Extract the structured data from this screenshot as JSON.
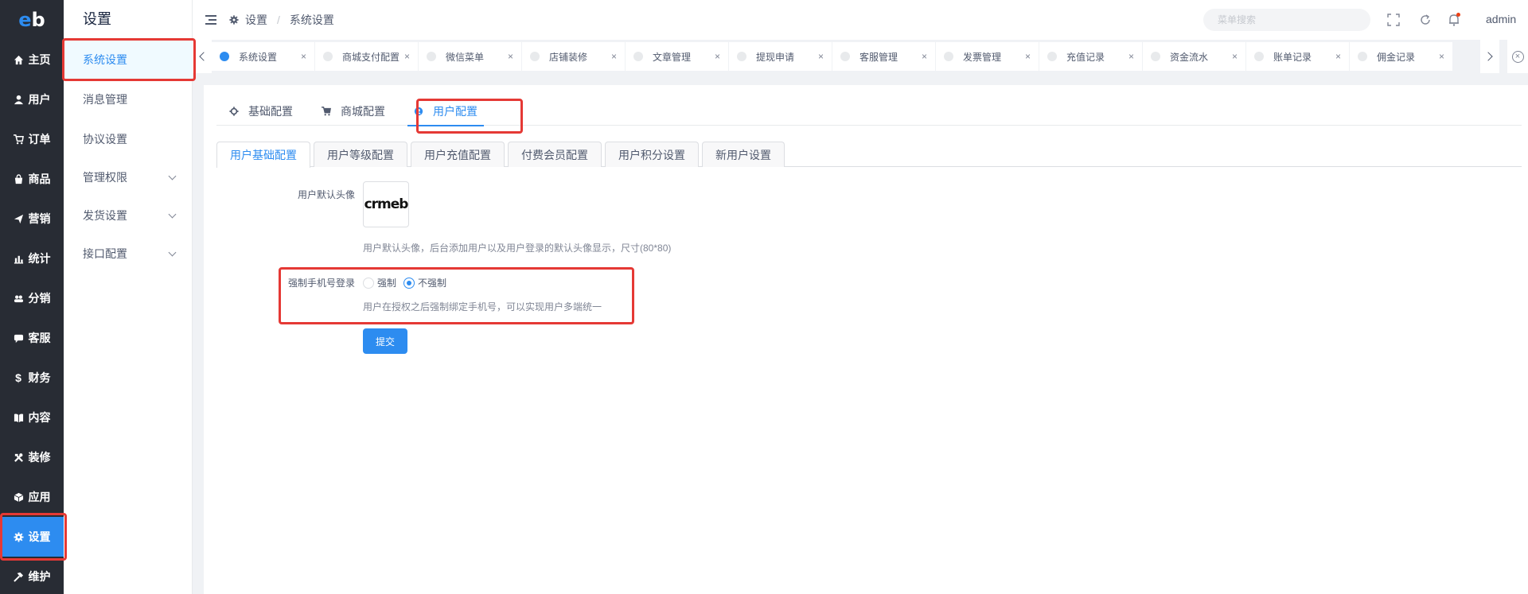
{
  "logo": {
    "text_e": "e",
    "text_b": "b"
  },
  "nav": [
    {
      "label": "主页",
      "icon": "home-icon"
    },
    {
      "label": "用户",
      "icon": "user-icon"
    },
    {
      "label": "订单",
      "icon": "cart-icon"
    },
    {
      "label": "商品",
      "icon": "shop-icon"
    },
    {
      "label": "营销",
      "icon": "send-icon"
    },
    {
      "label": "统计",
      "icon": "bar-chart-icon"
    },
    {
      "label": "分销",
      "icon": "people-icon"
    },
    {
      "label": "客服",
      "icon": "chat-icon"
    },
    {
      "label": "财务",
      "icon": "dollar-icon"
    },
    {
      "label": "内容",
      "icon": "book-icon"
    },
    {
      "label": "装修",
      "icon": "tools-icon"
    },
    {
      "label": "应用",
      "icon": "cube-icon"
    },
    {
      "label": "设置",
      "icon": "gear-icon"
    },
    {
      "label": "维护",
      "icon": "hammer-icon"
    }
  ],
  "submenu": {
    "title": "设置",
    "items": [
      {
        "label": "系统设置"
      },
      {
        "label": "消息管理"
      },
      {
        "label": "协议设置"
      },
      {
        "label": "管理权限"
      },
      {
        "label": "发货设置"
      },
      {
        "label": "接口配置"
      }
    ]
  },
  "header": {
    "breadcrumb": [
      "设置",
      "系统设置"
    ],
    "breadcrumb_sep": "/",
    "search_placeholder": "菜单搜索",
    "user": "admin"
  },
  "tabs": [
    {
      "label": "系统设置",
      "close": "×"
    },
    {
      "label": "商城支付配置",
      "close": "×"
    },
    {
      "label": "微信菜单",
      "close": "×"
    },
    {
      "label": "店铺装修",
      "close": "×"
    },
    {
      "label": "文章管理",
      "close": "×"
    },
    {
      "label": "提现申请",
      "close": "×"
    },
    {
      "label": "客服管理",
      "close": "×"
    },
    {
      "label": "发票管理",
      "close": "×"
    },
    {
      "label": "充值记录",
      "close": "×"
    },
    {
      "label": "资金流水",
      "close": "×"
    },
    {
      "label": "账单记录",
      "close": "×"
    },
    {
      "label": "佣金记录",
      "close": "×"
    }
  ],
  "close_all": "×",
  "main_tabs": [
    "基础配置",
    "商城配置",
    "用户配置"
  ],
  "sub_tabs": [
    "用户基础配置",
    "用户等级配置",
    "用户充值配置",
    "付费会员配置",
    "用户积分设置",
    "新用户设置"
  ],
  "form": {
    "avatar_label": "用户默认头像",
    "avatar_text": "crmeb",
    "avatar_hint": "用户默认头像，后台添加用户以及用户登录的默认头像显示，尺寸(80*80)",
    "force_label": "强制手机号登录",
    "force_options": [
      "强制",
      "不强制"
    ],
    "force_selected": "不强制",
    "force_hint": "用户在授权之后强制绑定手机号，可以实现用户多端统一",
    "submit": "提交"
  },
  "colors": {
    "accent": "#2d8cf0",
    "sidebar": "#282c34",
    "annotation": "#e53935"
  }
}
